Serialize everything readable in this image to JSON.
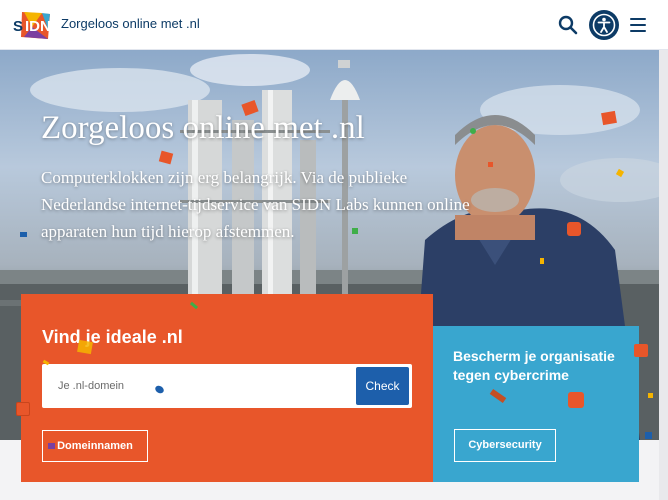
{
  "header": {
    "logo_text": "SIDN",
    "site_title": "Zorgeloos online met .nl",
    "icons": {
      "search": "search-icon",
      "accessibility": "accessibility-icon",
      "menu": "hamburger-menu-icon"
    }
  },
  "hero": {
    "title": "Zorgeloos online met .nl",
    "text": "Computerklokken zijn erg belangrijk. Via de publieke Nederlandse internet-tijdservice van SIDN Labs kunnen online apparaten hun tijd hierop afstemmen."
  },
  "domain_search": {
    "title": "Vind je ideale .nl",
    "placeholder": "Je .nl-domein",
    "value": "",
    "button_label": "Check",
    "link_label": "Domeinnamen"
  },
  "cyber_card": {
    "title": "Bescherm je organisatie tegen cybercrime",
    "link_label": "Cybersecurity"
  },
  "colors": {
    "brand_blue": "#0d3b66",
    "orange": "#e8562a",
    "light_blue": "#39a6cf",
    "button_blue": "#1d5fab"
  }
}
